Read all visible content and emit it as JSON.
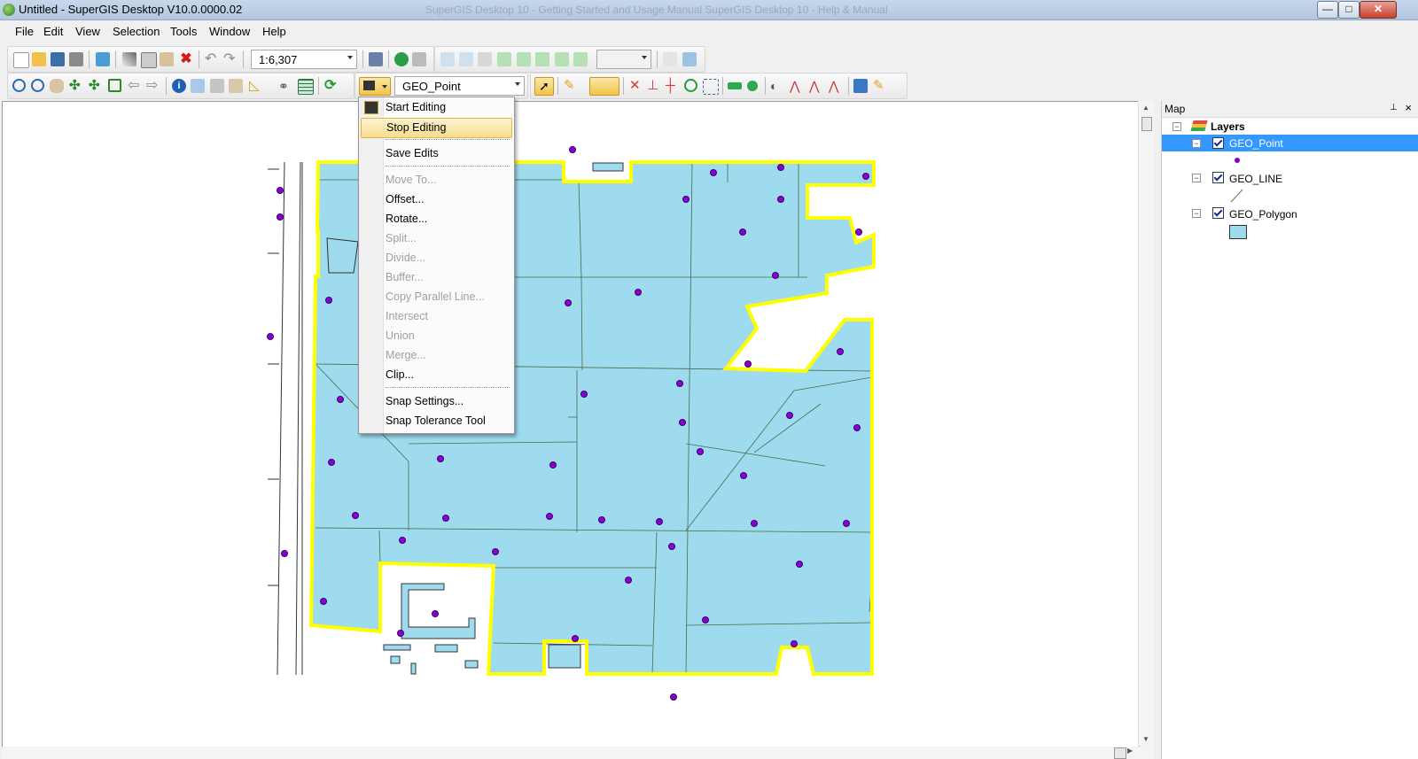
{
  "window": {
    "title": "Untitled - SuperGIS Desktop V10.0.0000.02",
    "background_title": "SuperGIS Desktop 10 - Getting Started and Usage Manual SuperGIS Desktop 10 - Help & Manual",
    "buttons": {
      "minimize": "—",
      "maximize": "□",
      "close": "✕"
    }
  },
  "menubar": {
    "items": [
      "File",
      "Edit",
      "View",
      "Selection",
      "Tools",
      "Window",
      "Help"
    ]
  },
  "toolbar": {
    "scale_value": "1:6,307",
    "target_layer": "GEO_Point"
  },
  "editor_menu": {
    "items": [
      {
        "label": "Start Editing",
        "enabled": true,
        "icon": "editor-icon"
      },
      {
        "label": "Stop Editing",
        "enabled": true,
        "highlighted": true
      },
      {
        "label": "Save Edits",
        "enabled": true
      },
      {
        "label": "Move To...",
        "enabled": false
      },
      {
        "label": "Offset...",
        "enabled": true
      },
      {
        "label": "Rotate...",
        "enabled": true
      },
      {
        "label": "Split...",
        "enabled": false
      },
      {
        "label": "Divide...",
        "enabled": false
      },
      {
        "label": "Buffer...",
        "enabled": false
      },
      {
        "label": "Copy Parallel Line...",
        "enabled": false
      },
      {
        "label": "Intersect",
        "enabled": false
      },
      {
        "label": "Union",
        "enabled": false
      },
      {
        "label": "Merge...",
        "enabled": false
      },
      {
        "label": "Clip...",
        "enabled": true
      },
      {
        "label": "Snap Settings...",
        "enabled": true
      },
      {
        "label": "Snap Tolerance Tool",
        "enabled": true
      }
    ]
  },
  "map_panel": {
    "title": "Map",
    "root": "Layers",
    "layers": [
      {
        "name": "GEO_Point",
        "checked": true,
        "selected": true,
        "symbol": "point"
      },
      {
        "name": "GEO_LINE",
        "checked": true,
        "selected": false,
        "symbol": "line"
      },
      {
        "name": "GEO_Polygon",
        "checked": true,
        "selected": false,
        "symbol": "polygon"
      }
    ]
  },
  "colors": {
    "polygon_fill": "#9fdbee",
    "selection_outline": "#ffff00",
    "point_fill": "#8a00d4",
    "highlight_row": "#3399ff"
  }
}
